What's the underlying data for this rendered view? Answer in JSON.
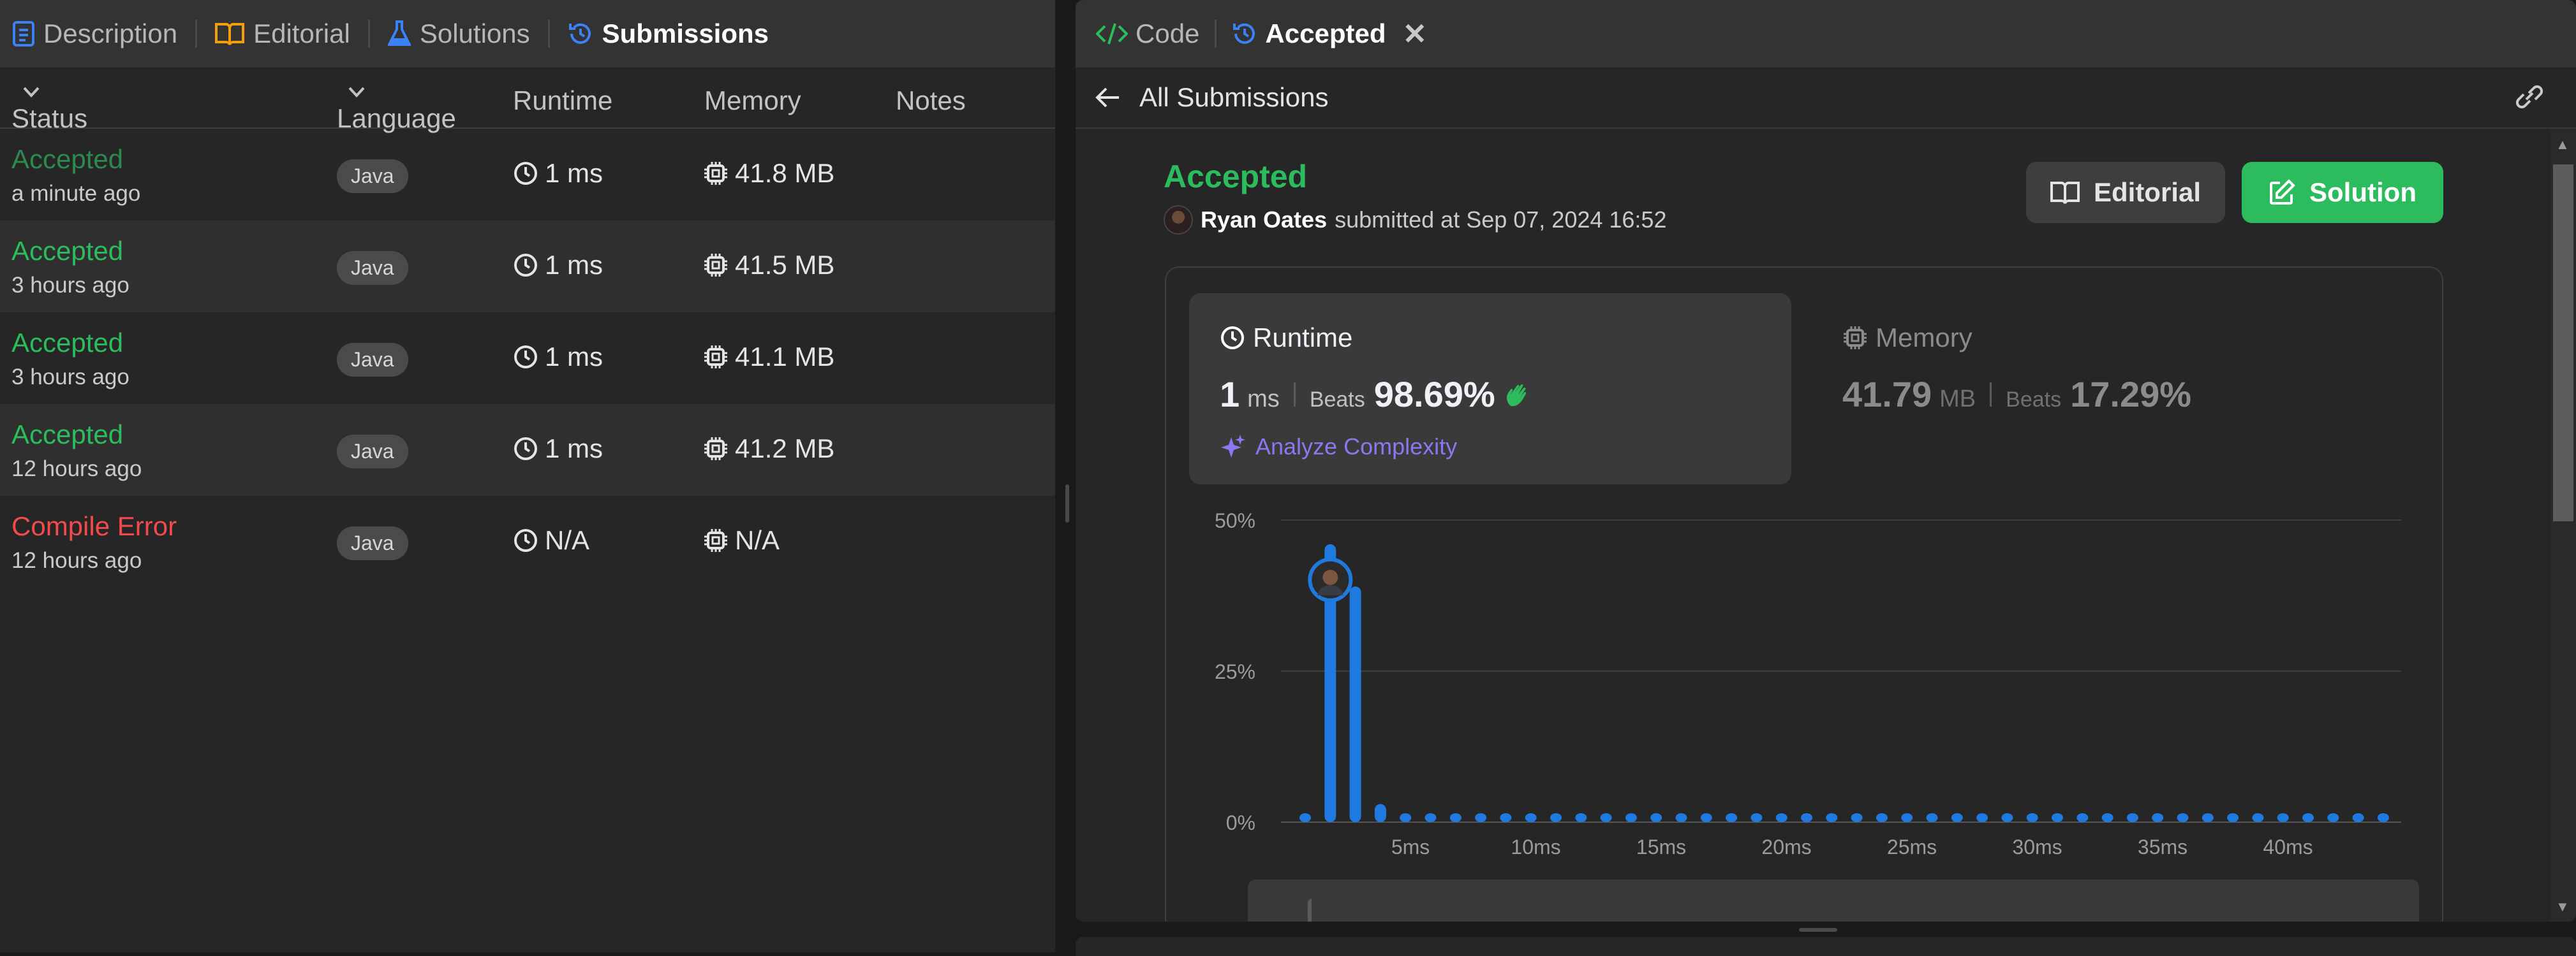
{
  "left_tabs": [
    {
      "label": "Description",
      "icon": "description-icon",
      "color": "#3b82f6"
    },
    {
      "label": "Editorial",
      "icon": "book-icon",
      "color": "#f59e0b"
    },
    {
      "label": "Solutions",
      "icon": "flask-icon",
      "color": "#3b82f6"
    },
    {
      "label": "Submissions",
      "icon": "history-icon",
      "color": "#3b82f6"
    }
  ],
  "columns": {
    "status": "Status",
    "language": "Language",
    "runtime": "Runtime",
    "memory": "Memory",
    "notes": "Notes"
  },
  "submissions": [
    {
      "status": "Accepted",
      "time": "a minute ago",
      "language": "Java",
      "runtime": "1 ms",
      "memory": "41.8 MB"
    },
    {
      "status": "Accepted",
      "time": "3 hours ago",
      "language": "Java",
      "runtime": "1 ms",
      "memory": "41.5 MB"
    },
    {
      "status": "Accepted",
      "time": "3 hours ago",
      "language": "Java",
      "runtime": "1 ms",
      "memory": "41.1 MB"
    },
    {
      "status": "Accepted",
      "time": "12 hours ago",
      "language": "Java",
      "runtime": "1 ms",
      "memory": "41.2 MB"
    },
    {
      "status": "Compile Error",
      "time": "12 hours ago",
      "language": "Java",
      "runtime": "N/A",
      "memory": "N/A"
    }
  ],
  "right_tabs": {
    "code": "Code",
    "accepted": "Accepted",
    "close": "✕"
  },
  "subnav": {
    "back_label": "All Submissions"
  },
  "detail": {
    "title": "Accepted",
    "author": "Ryan Oates",
    "submitted_text": "submitted at Sep 07, 2024 16:52",
    "editorial_button": "Editorial",
    "solution_button": "Solution"
  },
  "runtime_card": {
    "label": "Runtime",
    "value": "1",
    "unit": "ms",
    "beats_label": "Beats",
    "beats_pct": "98.69%",
    "analyze_label": "Analyze Complexity"
  },
  "memory_card": {
    "label": "Memory",
    "value": "41.79",
    "unit": "MB",
    "beats_label": "Beats",
    "beats_pct": "17.29%"
  },
  "colors": {
    "accepted": "#2cbb5d",
    "error": "#f34b4b",
    "bar": "#1f7ae0",
    "accent_purple": "#8b78f0"
  },
  "chart_data": {
    "type": "bar",
    "ylabel": "",
    "xlabel": "",
    "y_ticks": [
      "50%",
      "25%",
      "0%"
    ],
    "x_ticks": [
      "5ms",
      "10ms",
      "15ms",
      "20ms",
      "25ms",
      "30ms",
      "35ms",
      "40ms"
    ],
    "ylim": [
      0,
      50
    ],
    "values": [
      1,
      46,
      39,
      3,
      1,
      1,
      1,
      1,
      1,
      1,
      1,
      1,
      1,
      1,
      1,
      1,
      1,
      1,
      1,
      1,
      1,
      1,
      1,
      1,
      1,
      1,
      1,
      1,
      1,
      1,
      1,
      1,
      1,
      1,
      1,
      1,
      1,
      1,
      1,
      1,
      1,
      1,
      1,
      1
    ],
    "highlight_index": 1
  }
}
